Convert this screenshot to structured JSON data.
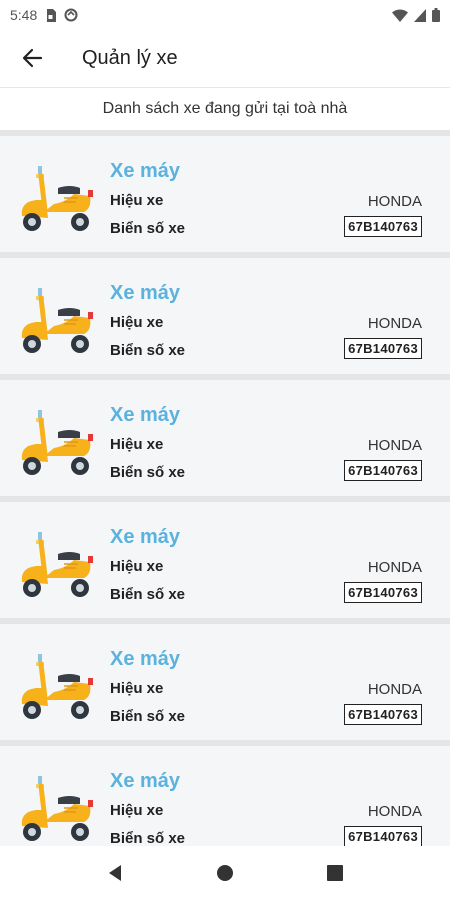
{
  "status_bar": {
    "time": "5:48",
    "icons": [
      "sim-icon",
      "sync-icon",
      "wifi-icon",
      "signal-icon",
      "battery-icon"
    ]
  },
  "app_bar": {
    "title": "Quản lý xe",
    "back_icon": "arrow-left-icon"
  },
  "subtitle": "Danh sách xe đang gửi tại toà nhà",
  "colors": {
    "accent": "#5ab2dd",
    "card_bg": "#f4f6f8",
    "divider": "#e5e5e5",
    "scooter": "#f7b21b"
  },
  "vehicles": [
    {
      "type": "Xe máy",
      "brand_label": "Hiệu xe",
      "brand": "HONDA",
      "plate_label": "Biển số xe",
      "plate": "67B140763"
    },
    {
      "type": "Xe máy",
      "brand_label": "Hiệu xe",
      "brand": "HONDA",
      "plate_label": "Biển số xe",
      "plate": "67B140763"
    },
    {
      "type": "Xe máy",
      "brand_label": "Hiệu xe",
      "brand": "HONDA",
      "plate_label": "Biển số xe",
      "plate": "67B140763"
    },
    {
      "type": "Xe máy",
      "brand_label": "Hiệu xe",
      "brand": "HONDA",
      "plate_label": "Biển số xe",
      "plate": "67B140763"
    },
    {
      "type": "Xe máy",
      "brand_label": "Hiệu xe",
      "brand": "HONDA",
      "plate_label": "Biển số xe",
      "plate": "67B140763"
    },
    {
      "type": "Xe máy",
      "brand_label": "Hiệu xe",
      "brand": "HONDA",
      "plate_label": "Biển số xe",
      "plate": "67B140763"
    }
  ],
  "nav_bar": {
    "icons": [
      "back-triangle-icon",
      "home-circle-icon",
      "recents-square-icon"
    ]
  }
}
